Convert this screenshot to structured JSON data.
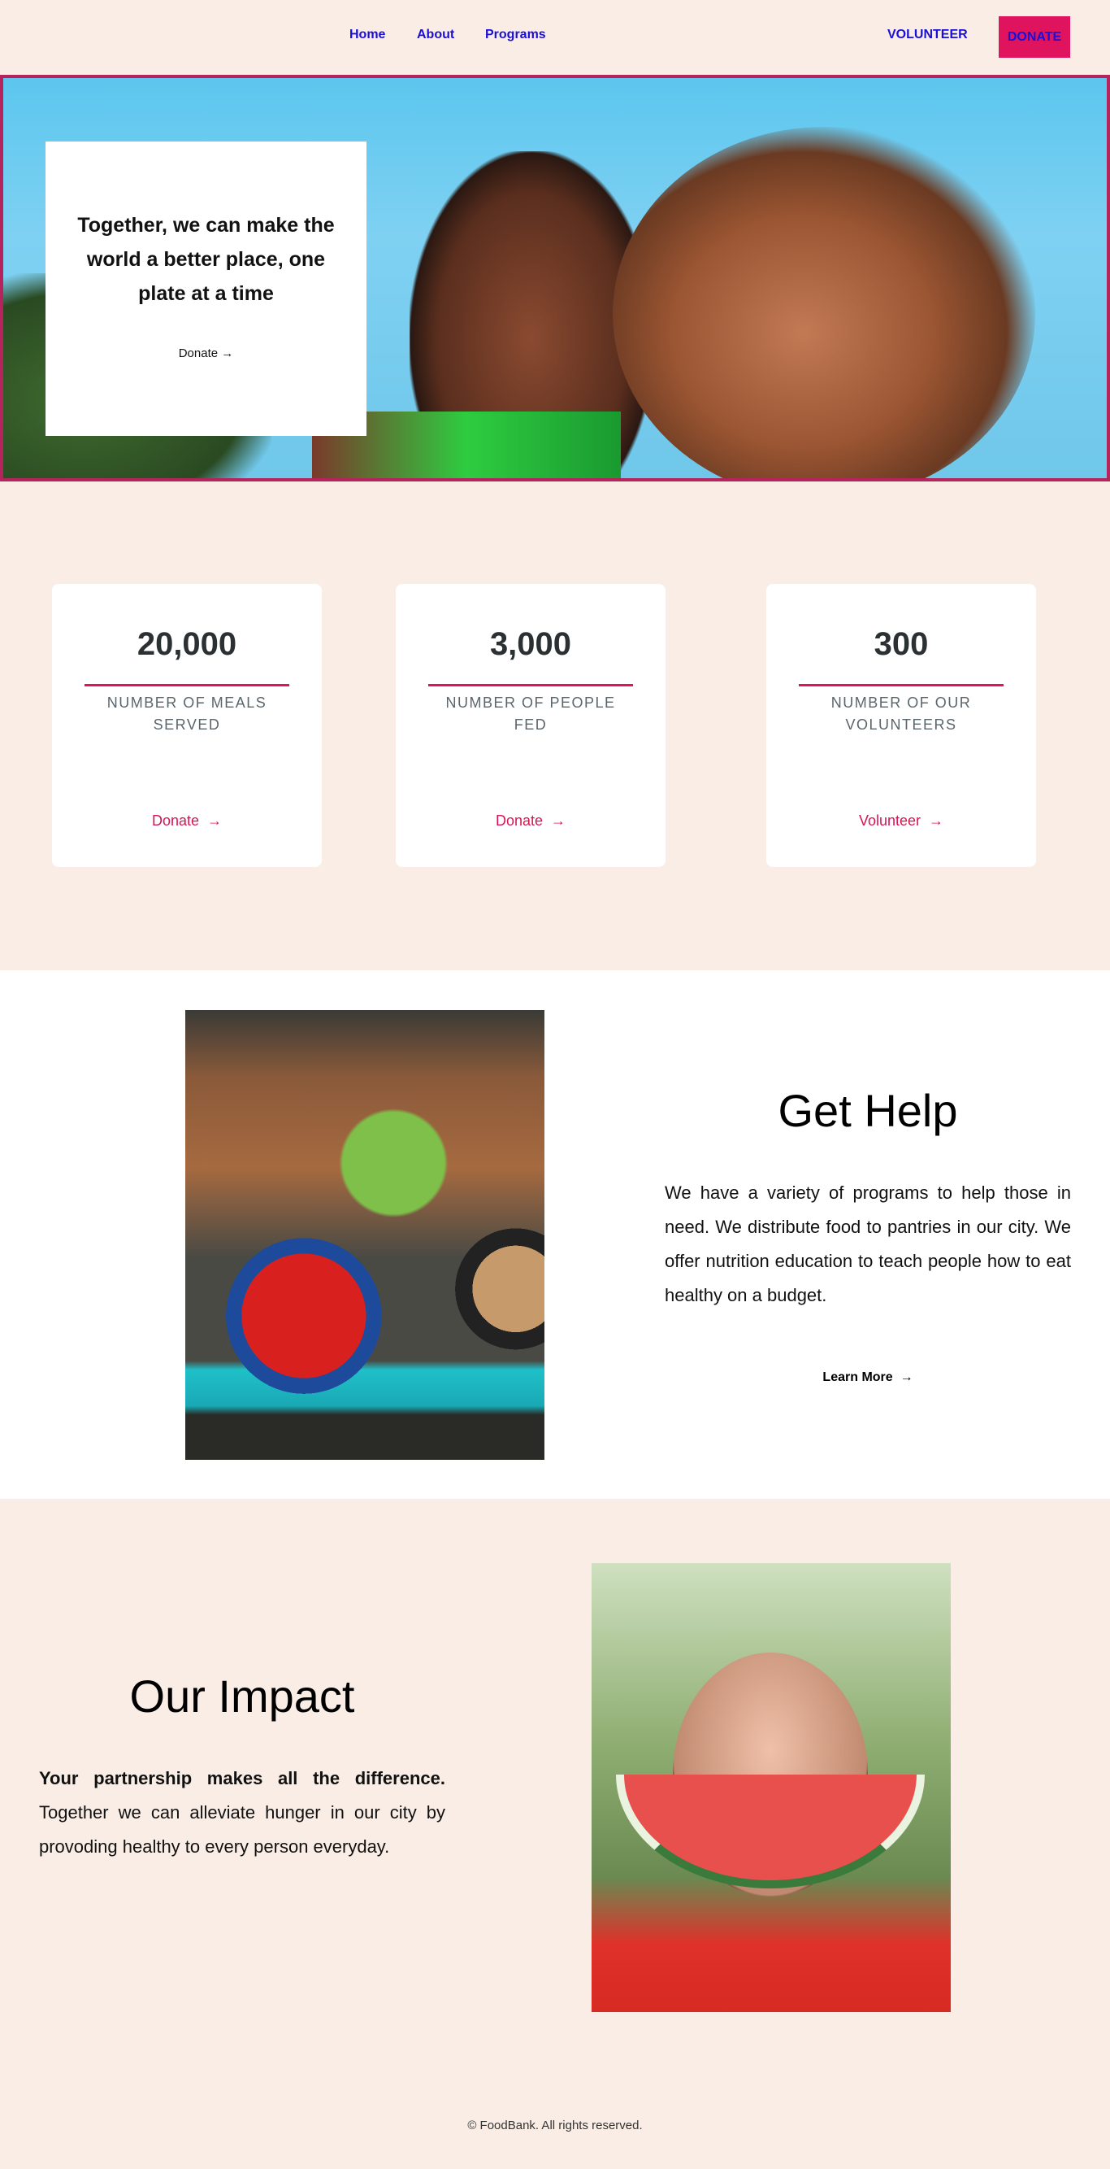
{
  "nav": {
    "links": [
      "Home",
      "About",
      "Programs"
    ],
    "volunteer": "VOLUNTEER",
    "donate": "DONATE"
  },
  "hero": {
    "title": "Together, we can make the world a better place, one plate at a time",
    "link": "Donate"
  },
  "stats": [
    {
      "number": "20,000",
      "label": "NUMBER OF MEALS SERVED",
      "link": "Donate"
    },
    {
      "number": "3,000",
      "label": "NUMBER OF PEOPLE FED",
      "link": "Donate"
    },
    {
      "number": "300",
      "label": "NUMBER OF OUR VOLUNTEERS",
      "link": "Volunteer"
    }
  ],
  "help": {
    "title": "Get Help",
    "text": "We have a variety of programs to help those in need. We distribute food to pantries in our city. We offer nutrition education to teach people how to eat healthy on a budget.",
    "link": "Learn More"
  },
  "impact": {
    "title": "Our Impact",
    "bold": "Your partnership makes all the difference.",
    "text": " Together we can alleviate hunger in our city by provoding healthy to every person everyday."
  },
  "footer": {
    "text": "© FoodBank. All rights reserved."
  },
  "icons": {
    "arrow": "→"
  },
  "colors": {
    "accent": "#e0145e",
    "nav_link": "#1a0fd6",
    "background": "#faede5"
  }
}
